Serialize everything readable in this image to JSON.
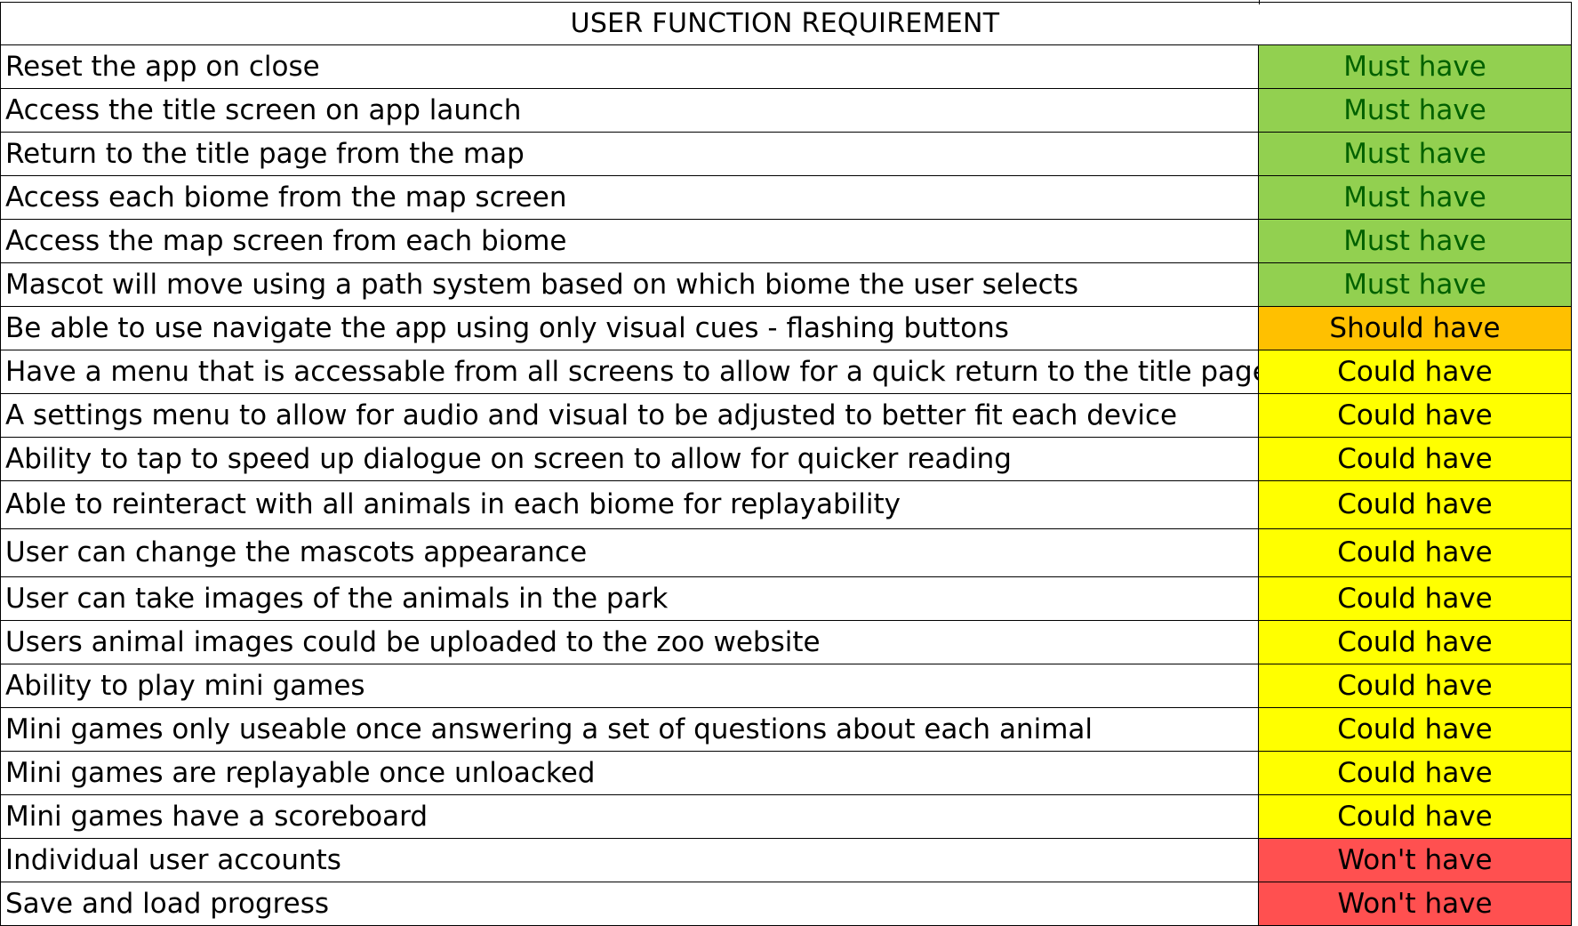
{
  "title": "USER FUNCTION REQUIREMENT",
  "colors": {
    "must_have_fill": "#92d050",
    "must_have_text": "#006100",
    "should_have_fill": "#ffc000",
    "could_have_fill": "#ffff00",
    "wont_have_fill": "#ff5050"
  },
  "rows": [
    {
      "requirement": "Reset the app on close",
      "priority": "Must have",
      "level": "must"
    },
    {
      "requirement": "Access the title screen on app launch",
      "priority": "Must have",
      "level": "must"
    },
    {
      "requirement": "Return to the title page from the map",
      "priority": "Must have",
      "level": "must"
    },
    {
      "requirement": "Access each biome from the map screen",
      "priority": "Must have",
      "level": "must"
    },
    {
      "requirement": "Access the map screen from each biome",
      "priority": "Must have",
      "level": "must"
    },
    {
      "requirement": "Mascot will move using a path system based on which biome the user selects",
      "priority": "Must have",
      "level": "must"
    },
    {
      "requirement": "Be able to use navigate the app using only visual cues - flashing buttons",
      "priority": "Should have",
      "level": "should"
    },
    {
      "requirement": "Have a menu that is accessable from all screens to allow for a quick return to the title page",
      "priority": "Could have",
      "level": "could"
    },
    {
      "requirement": "A settings menu to allow for audio and visual to be adjusted to better fit each device",
      "priority": "Could have",
      "level": "could"
    },
    {
      "requirement": "Ability to tap to speed up dialogue on screen to allow for quicker reading",
      "priority": "Could have",
      "level": "could"
    },
    {
      "requirement": "Able to reinteract with all animals in each biome for replayability",
      "priority": "Could have",
      "level": "could"
    },
    {
      "requirement": "User can change the mascots appearance",
      "priority": "Could have",
      "level": "could"
    },
    {
      "requirement": "User can take images of the animals in the park",
      "priority": "Could have",
      "level": "could"
    },
    {
      "requirement": "Users animal images could be uploaded to the zoo website",
      "priority": "Could have",
      "level": "could"
    },
    {
      "requirement": "Ability to play mini games",
      "priority": "Could have",
      "level": "could"
    },
    {
      "requirement": "Mini games only useable once answering a set of questions about each animal",
      "priority": "Could have",
      "level": "could"
    },
    {
      "requirement": "Mini games are replayable once unloacked",
      "priority": "Could have",
      "level": "could"
    },
    {
      "requirement": "Mini games have a scoreboard",
      "priority": "Could have",
      "level": "could"
    },
    {
      "requirement": "Individual user accounts",
      "priority": "Won't have",
      "level": "wont"
    },
    {
      "requirement": "Save and load progress",
      "priority": "Won't have",
      "level": "wont"
    }
  ]
}
